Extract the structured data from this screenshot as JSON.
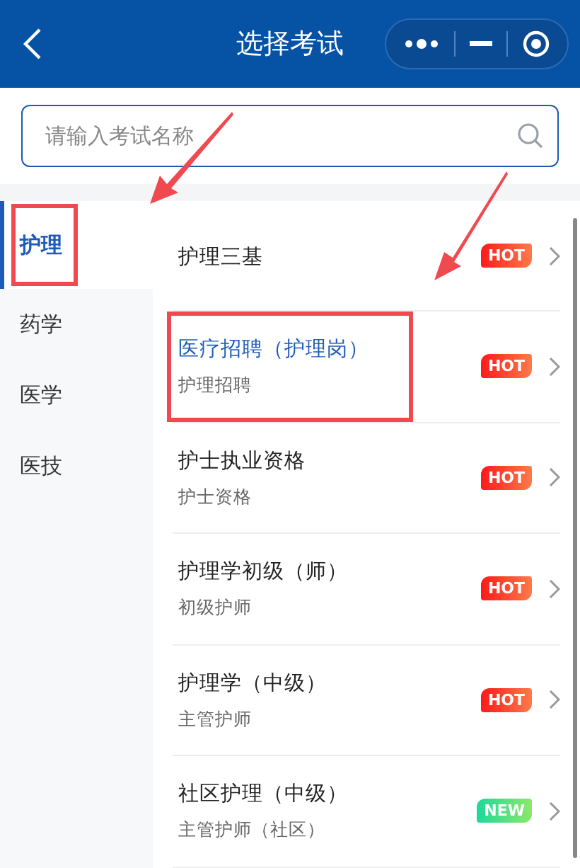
{
  "header": {
    "title": "选择考试"
  },
  "search": {
    "placeholder": "请输入考试名称"
  },
  "sidebar": {
    "items": [
      {
        "label": "护理",
        "selected": true,
        "annotated": true
      },
      {
        "label": "药学",
        "selected": false,
        "annotated": false
      },
      {
        "label": "医学",
        "selected": false,
        "annotated": false
      },
      {
        "label": "医技",
        "selected": false,
        "annotated": false
      }
    ]
  },
  "exams": [
    {
      "title": "护理三基",
      "selected": false,
      "annotated": false,
      "tag": {
        "label": "HOT",
        "kind": "hot"
      }
    },
    {
      "title": "医疗招聘（护理岗）",
      "subtitle": "护理招聘",
      "selected": true,
      "annotated": true,
      "tag": {
        "label": "HOT",
        "kind": "hot"
      }
    },
    {
      "title": "护士执业资格",
      "subtitle": "护士资格",
      "selected": false,
      "annotated": false,
      "tag": {
        "label": "HOT",
        "kind": "hot"
      }
    },
    {
      "title": "护理学初级（师）",
      "subtitle": "初级护师",
      "selected": false,
      "annotated": false,
      "tag": {
        "label": "HOT",
        "kind": "hot"
      }
    },
    {
      "title": "护理学（中级）",
      "subtitle": "主管护师",
      "selected": false,
      "annotated": false,
      "tag": {
        "label": "HOT",
        "kind": "hot"
      }
    },
    {
      "title": "社区护理（中级）",
      "subtitle": "主管护师（社区）",
      "selected": false,
      "annotated": false,
      "tag": {
        "label": "NEW",
        "kind": "new"
      }
    }
  ]
}
